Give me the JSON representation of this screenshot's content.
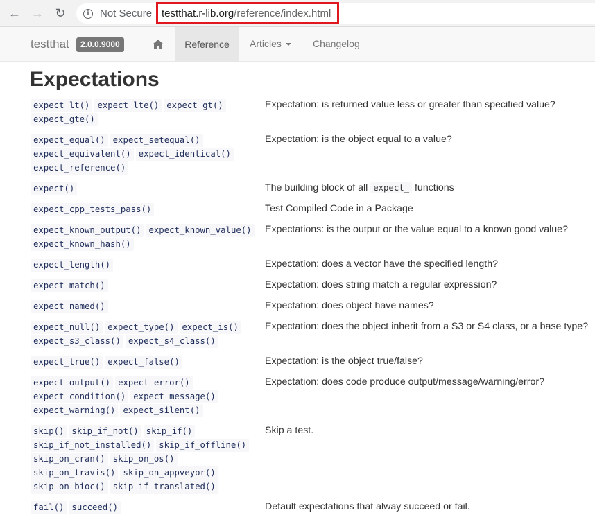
{
  "browser": {
    "not_secure": "Not Secure",
    "url_host": "testthat.r-lib.org",
    "url_path": "/reference/index.html"
  },
  "navbar": {
    "brand": "testthat",
    "version": "2.0.0.9000",
    "reference": "Reference",
    "articles": "Articles",
    "changelog": "Changelog"
  },
  "page": {
    "title": "Expectations"
  },
  "rows": [
    {
      "fns": [
        [
          "expect_lt()",
          "expect_lte()",
          "expect_gt()"
        ],
        [
          "expect_gte()"
        ]
      ],
      "desc": "Expectation: is returned value less or greater than specified value?"
    },
    {
      "fns": [
        [
          "expect_equal()",
          "expect_setequal()"
        ],
        [
          "expect_equivalent()",
          "expect_identical()"
        ],
        [
          "expect_reference()"
        ]
      ],
      "desc": "Expectation: is the object equal to a value?"
    },
    {
      "fns": [
        [
          "expect()"
        ]
      ],
      "desc_pre": "The building block of all ",
      "desc_code": "expect_",
      "desc_post": " functions"
    },
    {
      "fns": [
        [
          "expect_cpp_tests_pass()"
        ]
      ],
      "desc": "Test Compiled Code in a Package"
    },
    {
      "fns": [
        [
          "expect_known_output()",
          "expect_known_value()"
        ],
        [
          "expect_known_hash()"
        ]
      ],
      "desc": "Expectations: is the output or the value equal to a known good value?"
    },
    {
      "fns": [
        [
          "expect_length()"
        ]
      ],
      "desc": "Expectation: does a vector have the specified length?"
    },
    {
      "fns": [
        [
          "expect_match()"
        ]
      ],
      "desc": "Expectation: does string match a regular expression?"
    },
    {
      "fns": [
        [
          "expect_named()"
        ]
      ],
      "desc": "Expectation: does object have names?"
    },
    {
      "fns": [
        [
          "expect_null()",
          "expect_type()",
          "expect_is()"
        ],
        [
          "expect_s3_class()",
          "expect_s4_class()"
        ]
      ],
      "desc": "Expectation: does the object inherit from a S3 or S4 class, or a base type?"
    },
    {
      "fns": [
        [
          "expect_true()",
          "expect_false()"
        ]
      ],
      "desc": "Expectation: is the object true/false?"
    },
    {
      "fns": [
        [
          "expect_output()",
          "expect_error()"
        ],
        [
          "expect_condition()",
          "expect_message()"
        ],
        [
          "expect_warning()",
          "expect_silent()"
        ]
      ],
      "desc": "Expectation: does code produce output/message/warning/error?"
    },
    {
      "fns": [
        [
          "skip()",
          "skip_if_not()",
          "skip_if()"
        ],
        [
          "skip_if_not_installed()",
          "skip_if_offline()"
        ],
        [
          "skip_on_cran()",
          "skip_on_os()"
        ],
        [
          "skip_on_travis()",
          "skip_on_appveyor()"
        ],
        [
          "skip_on_bioc()",
          "skip_if_translated()"
        ]
      ],
      "desc": "Skip a test."
    },
    {
      "fns": [
        [
          "fail()",
          "succeed()"
        ]
      ],
      "desc": "Default expectations that alway succeed or fail."
    }
  ]
}
